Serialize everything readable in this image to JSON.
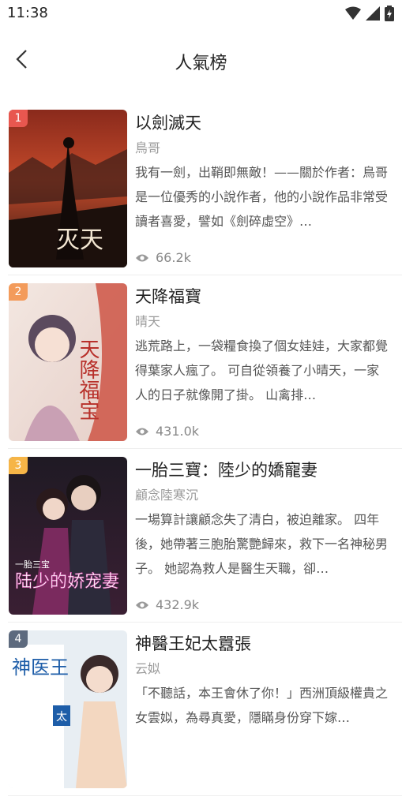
{
  "status": {
    "time": "11:38"
  },
  "header": {
    "title": "人氣榜"
  },
  "books": [
    {
      "rank": "1",
      "title": "以劍滅天",
      "author": "鳥哥",
      "desc": "我有一劍，出鞘即無敵！——關於作者：鳥哥是一位優秀的小說作者，他的小說作品非常受讀者喜愛，譬如《劍碎虛空》…",
      "views": "66.2k",
      "cover_text": "灭天"
    },
    {
      "rank": "2",
      "title": "天降福寶",
      "author": "晴天",
      "desc": "逃荒路上，一袋糧食換了個女娃娃，大家都覺得葉家人瘋了。 可自從領養了小晴天，一家人的日子就像開了掛。 山禽排…",
      "views": "431.0k",
      "cover_text": "天降福宝"
    },
    {
      "rank": "3",
      "title": "一胎三寶：陸少的嬌寵妻",
      "author": "顧念陸寒沉",
      "desc": "一場算計讓顧念失了清白，被迫離家。 四年後，她帶著三胞胎驚艷歸來，救下一名神秘男子。 她認為救人是醫生天職，卻…",
      "views": "432.9k",
      "cover_text": "陆少的娇宠妻",
      "cover_sub": "一胎三宝"
    },
    {
      "rank": "4",
      "title": "神醫王妃太囂張",
      "author": "云姒",
      "desc": "「不聽話，本王會休了你！」西洲頂級權貴之女雲姒，為尋真愛，隱瞞身份穿下嫁…",
      "views": "",
      "cover_text": "神医王",
      "cover_sub": "太"
    }
  ]
}
